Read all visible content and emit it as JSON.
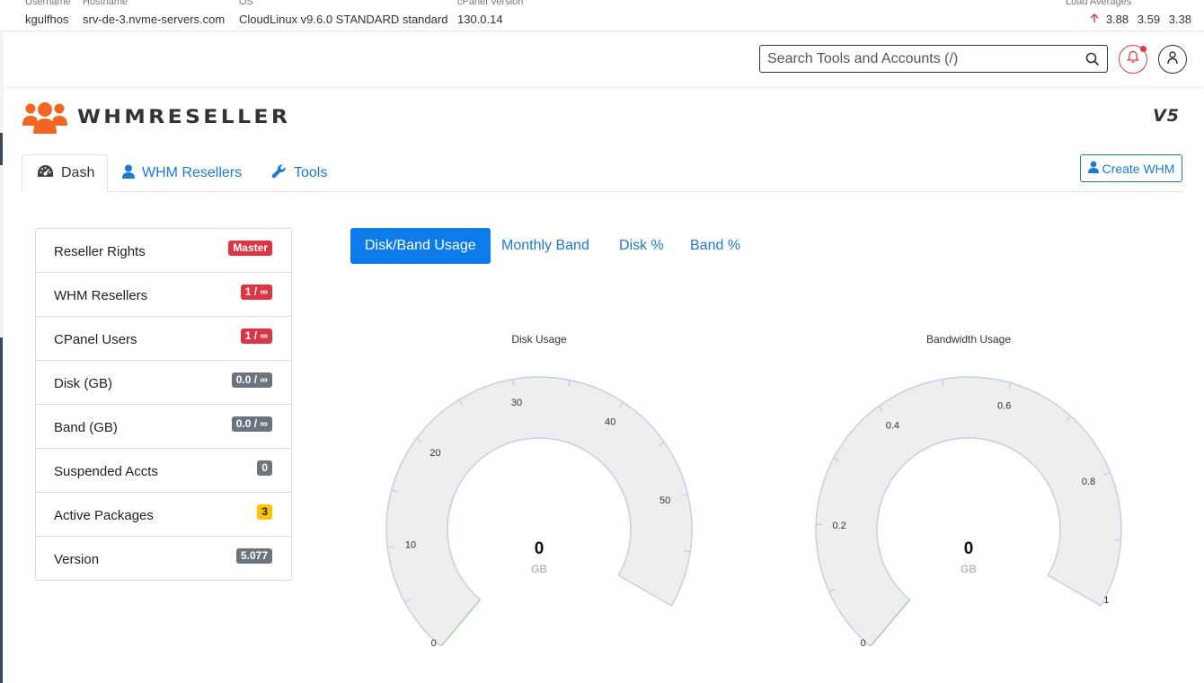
{
  "server_info": {
    "username": {
      "label": "Username",
      "value": "kgulfhos"
    },
    "hostname": {
      "label": "Hostname",
      "value": "srv-de-3.nvme-servers.com"
    },
    "os": {
      "label": "OS",
      "value": "CloudLinux v9.6.0 STANDARD standard"
    },
    "cpanel": {
      "label": "cPanel Version",
      "value": "130.0.14"
    },
    "load": {
      "label": "Load Averages",
      "values": [
        "3.88",
        "3.59",
        "3.38"
      ],
      "trend_icon": "arrow-up-icon"
    }
  },
  "header": {
    "search_placeholder": "Search Tools and Accounts (/)",
    "search_icon": "search-icon",
    "notification_icon": "bell-icon",
    "user_icon": "user-icon",
    "accent": "#e03a3a"
  },
  "brand": {
    "name": "WHMRESELLER",
    "version_mark": "V5",
    "logo_icon": "users-group-icon",
    "logo_color": "#f26522"
  },
  "tabs": [
    {
      "label": "Dash",
      "icon": "dashboard-icon",
      "active": true
    },
    {
      "label": "WHM Resellers",
      "icon": "user-icon",
      "active": false
    },
    {
      "label": "Tools",
      "icon": "wrench-icon",
      "active": false
    }
  ],
  "create_button": {
    "label": "Create WHM",
    "icon": "user-icon"
  },
  "stats": [
    {
      "name": "Reseller Rights",
      "badge": "Master",
      "badge_color": "red"
    },
    {
      "name": "WHM Resellers",
      "badge": "1 / ∞",
      "badge_color": "red"
    },
    {
      "name": "CPanel Users",
      "badge": "1 / ∞",
      "badge_color": "red"
    },
    {
      "name": "Disk (GB)",
      "badge": "0.0 / ∞",
      "badge_color": "gray"
    },
    {
      "name": "Band (GB)",
      "badge": "0.0 / ∞",
      "badge_color": "gray"
    },
    {
      "name": "Suspended Accts",
      "badge": "0",
      "badge_color": "gray"
    },
    {
      "name": "Active Packages",
      "badge": "3",
      "badge_color": "yellow"
    },
    {
      "name": "Version",
      "badge": "5.077",
      "badge_color": "gray"
    }
  ],
  "pills": [
    {
      "label": "Disk/Band Usage",
      "active": true
    },
    {
      "label": "Monthly Band",
      "active": false
    },
    {
      "label": "Disk %",
      "active": false
    },
    {
      "label": "Band %",
      "active": false
    }
  ],
  "colors": {
    "link": "#1a7ad6",
    "pill_active": "#0d7bea",
    "gauge_fill": "#eeeeee",
    "gauge_border": "#c5d0e3"
  },
  "chart_data": [
    {
      "type": "gauge",
      "title": "Disk Usage",
      "value": 0,
      "unit": "GB",
      "min": 0,
      "max": 60,
      "tick_labels": [
        "0",
        "10",
        "20",
        "30",
        "40",
        "50"
      ],
      "tick_values": [
        0,
        10,
        20,
        30,
        40,
        50
      ]
    },
    {
      "type": "gauge",
      "title": "Bandwidth Usage",
      "value": 0,
      "unit": "GB",
      "min": 0,
      "max": 1,
      "tick_labels": [
        "0",
        "0.2",
        "0.4",
        "0.6",
        "0.8",
        "1"
      ],
      "tick_values": [
        0,
        0.2,
        0.4,
        0.6,
        0.8,
        1
      ]
    }
  ]
}
